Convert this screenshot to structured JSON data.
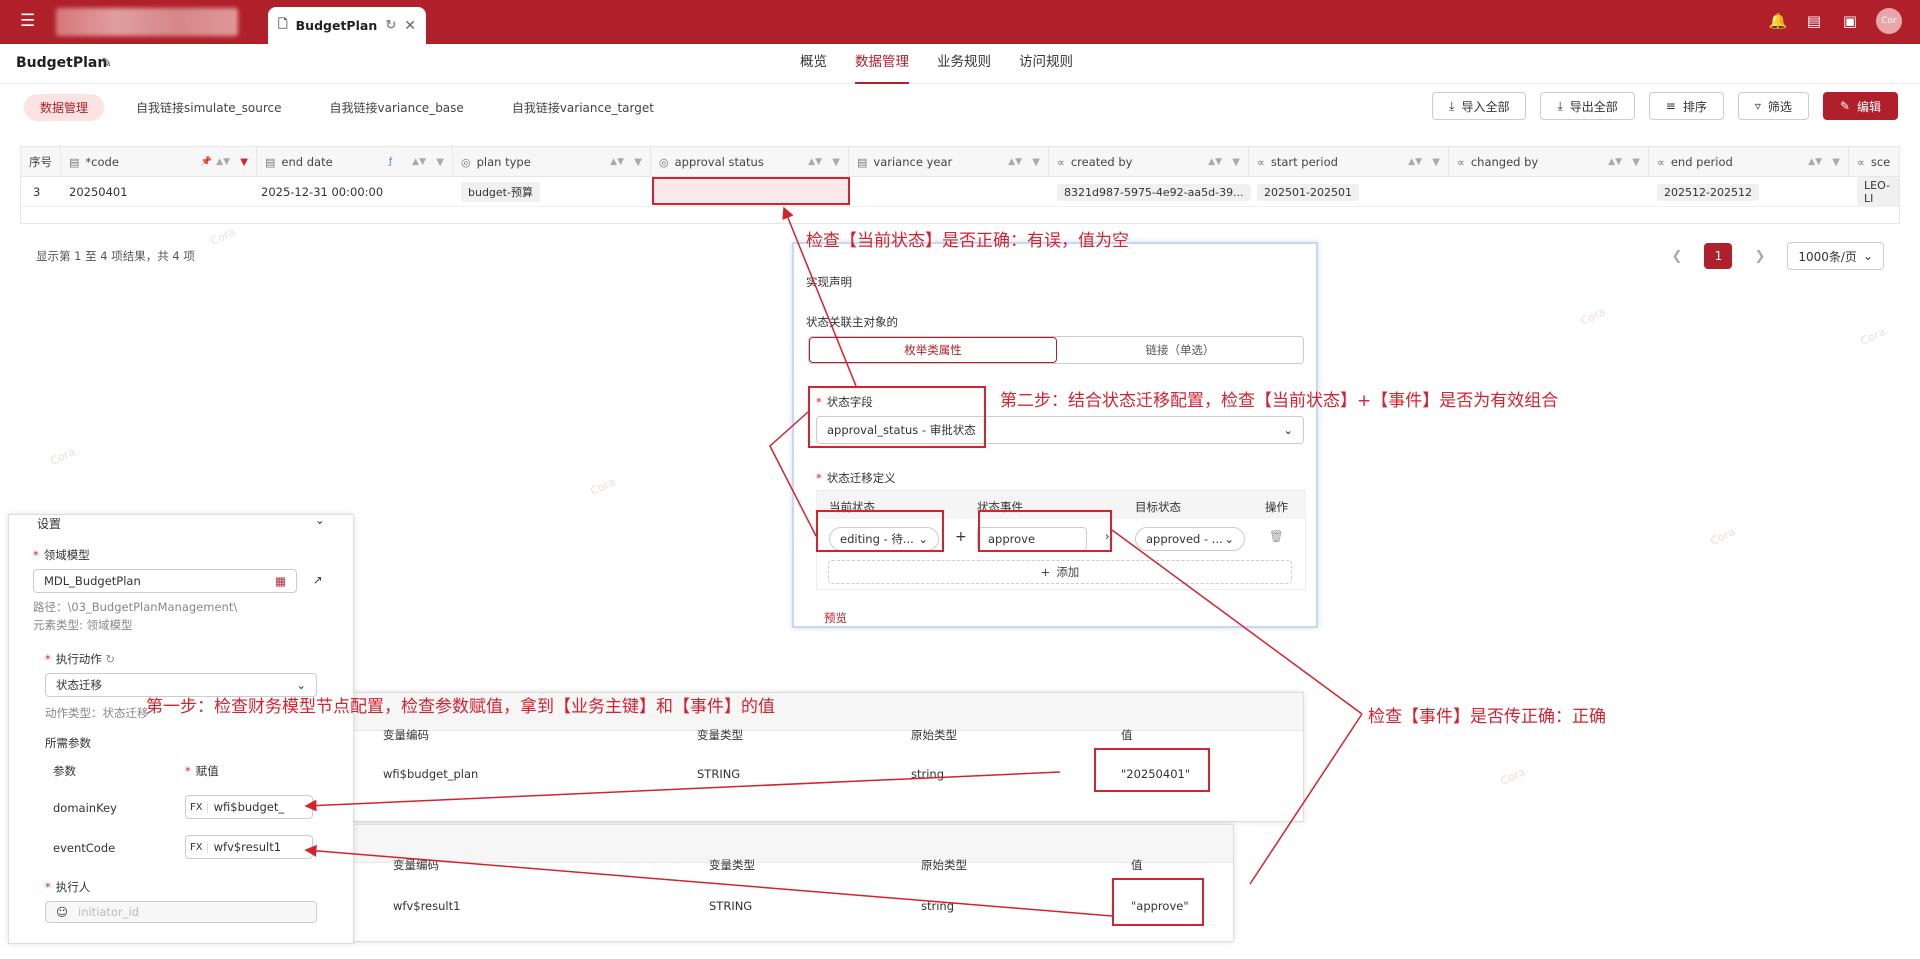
{
  "app": {
    "tab_title": "BudgetPlan",
    "avatar": "Cor"
  },
  "header": {
    "title": "BudgetPlan",
    "tabs": [
      "概览",
      "数据管理",
      "业务规则",
      "访问规则"
    ],
    "active_tab": "数据管理"
  },
  "subtabs": [
    "数据管理",
    "自我链接simulate_source",
    "自我链接variance_base",
    "自我链接variance_target"
  ],
  "actions": {
    "import_all": "导入全部",
    "export_all": "导出全部",
    "sort": "排序",
    "filter": "筛选",
    "edit": "编辑"
  },
  "grid": {
    "columns": [
      "序号",
      "*code",
      "end date",
      "plan type",
      "approval status",
      "variance year",
      "created by",
      "start period",
      "changed by",
      "end period",
      "sce"
    ],
    "row": {
      "index": "3",
      "code": "20250401",
      "end_date": "2025-12-31 00:00:00",
      "plan_type": "budget-预算",
      "approval_status": "",
      "variance_year": "",
      "created_by": "8321d987-5975-4e92-aa5d-39...",
      "start_period": "202501-202501",
      "changed_by": "",
      "end_period": "202512-202512",
      "sce": "LEO-LI"
    }
  },
  "pager": {
    "info": "显示第 1 至 4 项结果，共 4 项",
    "current": "1",
    "page_size": "1000条/页"
  },
  "state_panel": {
    "title": "实现声明",
    "assoc_label": "状态关联主对象的",
    "seg_enum": "枚举类属性",
    "seg_link": "链接（单选）",
    "field_label": "状态字段",
    "field_value": "approval_status - 审批状态",
    "trans_label": "状态迁移定义",
    "col_current": "当前状态",
    "col_event": "状态事件",
    "col_target": "目标状态",
    "col_op": "操作",
    "current_value": "editing - 待...",
    "event_value": "approve",
    "target_value": "approved - ...",
    "add": "添加",
    "preview": "预览"
  },
  "left_panel": {
    "section": "设置",
    "domain_label": "领域模型",
    "domain_value": "MDL_BudgetPlan",
    "path": "路径：\\03_BudgetPlanManagement\\",
    "elem_type": "元素类型: 领域模型",
    "action_label": "执行动作",
    "action_value": "状态迁移",
    "action_type": "动作类型：状态迁移",
    "params_label": "所需参数",
    "col_param": "参数",
    "col_assign": "赋值",
    "params": [
      {
        "name": "domainKey",
        "fx": "FX",
        "value": "wfi$budget_"
      },
      {
        "name": "eventCode",
        "fx": "FX",
        "value": "wfv$result1"
      }
    ],
    "executor_label": "执行人",
    "executor_placeholder": "initiator_id"
  },
  "var_table1": {
    "col_code": "变量编码",
    "col_type": "变量类型",
    "col_orig": "原始类型",
    "col_value": "值",
    "code": "wfi$budget_plan",
    "type": "STRING",
    "orig": "string",
    "value": "\"20250401\""
  },
  "var_table2": {
    "col_code": "变量编码",
    "col_type": "变量类型",
    "col_orig": "原始类型",
    "col_value": "值",
    "code": "wfv$result1",
    "type": "STRING",
    "orig": "string",
    "value": "\"approve\""
  },
  "annotations": {
    "a1": "检查【当前状态】是否正确：有误，值为空",
    "a2": "第二步：结合状态迁移配置，检查【当前状态】+【事件】是否为有效组合",
    "a3": "第一步：检查财务模型节点配置，检查参数赋值，拿到【业务主键】和【事件】的值",
    "a4": "检查【事件】是否传正确：正确"
  },
  "watermark": "Cora"
}
